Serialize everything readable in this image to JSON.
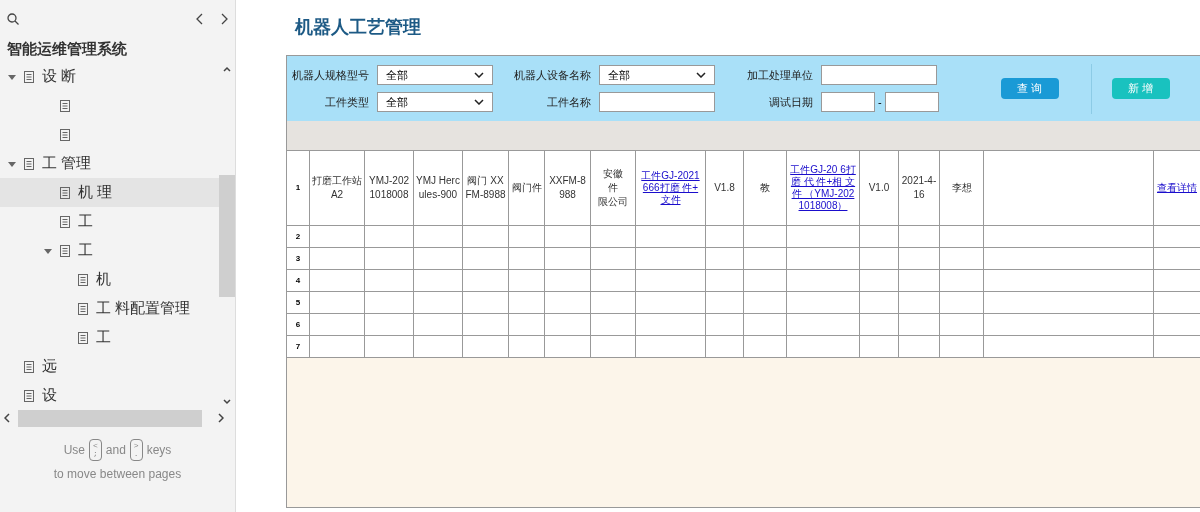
{
  "sidebar": {
    "title": "智能运维管理系统",
    "footer": {
      "use": "Use",
      "prev_key": "<\n;",
      "and": "and",
      "next_key": ">\n.",
      "keys": "keys",
      "line2": "to move between pages"
    },
    "tree": [
      {
        "label": "设 断",
        "expanded": true,
        "selected": false,
        "children": [
          {
            "selected": false
          },
          {
            "selected": false
          }
        ]
      },
      {
        "label": "工 管理",
        "expanded": true,
        "selected": false,
        "children": [
          {
            "label": "机 理",
            "selected": true
          },
          {
            "label": "工",
            "selected": false
          },
          {
            "label": "工",
            "expanded": true,
            "selected": false,
            "children": [
              {
                "label": "机",
                "selected": false
              },
              {
                "label": "工 料配置管理",
                "selected": false
              },
              {
                "label": "工",
                "selected": false
              }
            ]
          }
        ]
      },
      {
        "label": "远",
        "selected": false
      },
      {
        "label": "设",
        "selected": false
      }
    ]
  },
  "page": {
    "title": "机器人工艺管理",
    "filters": [
      {
        "kind": "select",
        "label": "机器人规格型号",
        "value": "全部"
      },
      {
        "kind": "select",
        "label": "机器人设备名称",
        "value": "全部"
      },
      {
        "kind": "input",
        "label": "加工处理单位"
      },
      {
        "kind": "select",
        "label": "工件类型",
        "value": "全部"
      },
      {
        "kind": "input",
        "label": "工件名称"
      },
      {
        "kind": "daterange",
        "label": "调试日期",
        "separator": "-"
      }
    ],
    "buttons": [
      {
        "label": "查 询",
        "color": "#1a9ad6"
      },
      {
        "label": "新 增",
        "color": "#19c2bf"
      }
    ],
    "table": {
      "rows": [
        [
          {
            "text": "1"
          },
          {
            "text": "打磨工作站 A2"
          },
          {
            "text": "YMJ-2021018008"
          },
          {
            "text": "YMJ Hercules-900"
          },
          {
            "text": "阀门 XXFM-8988"
          },
          {
            "text": "阀门件"
          },
          {
            "text": "XXFM-8988"
          },
          {
            "lines": [
              "安徽",
              "件",
              "限公司"
            ]
          },
          {
            "text": "工件GJ-2021 666打磨 件+ 文件",
            "kind": "link"
          },
          {
            "text": "V1.8"
          },
          {
            "text": "教"
          },
          {
            "text": "工件GJ-20 6打磨 代 件+相 文件 （YMJ-2021018008）",
            "kind": "link"
          },
          {
            "text": "V1.0"
          },
          {
            "text": "2021-4-16"
          },
          {
            "text": "李想"
          },
          {},
          {
            "text": "查看详情",
            "kind": "link"
          }
        ],
        [
          {
            "text": "2"
          }
        ],
        [
          {
            "text": "3"
          }
        ],
        [
          {
            "text": "4"
          }
        ],
        [
          {
            "text": "5"
          }
        ],
        [
          {
            "text": "6"
          }
        ],
        [
          {
            "text": "7"
          }
        ]
      ]
    }
  }
}
